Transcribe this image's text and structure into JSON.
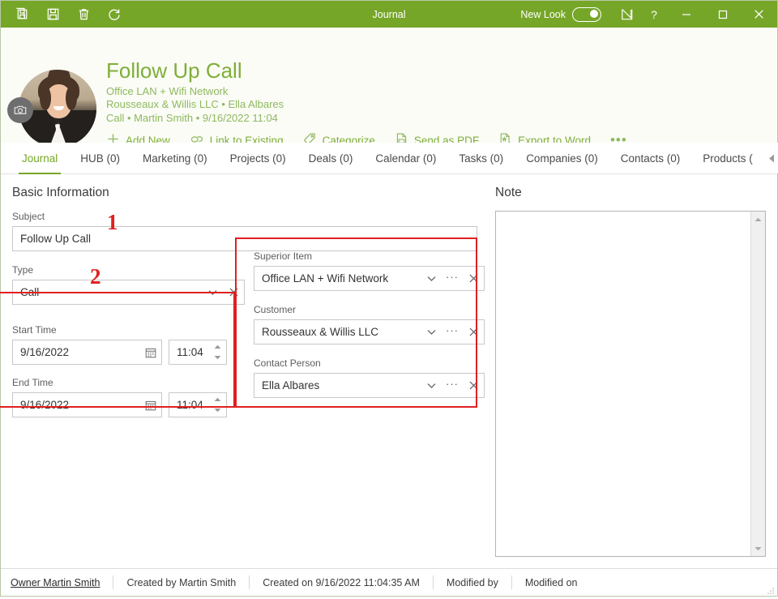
{
  "titlebar": {
    "title": "Journal",
    "buttons": [
      {
        "name": "save-and-new-icon",
        "label": "Save and New"
      },
      {
        "name": "save-icon",
        "label": "Save"
      },
      {
        "name": "delete-icon",
        "label": "Delete"
      },
      {
        "name": "refresh-icon",
        "label": "Refresh"
      }
    ],
    "new_look_label": "New Look",
    "new_look_on": true,
    "designer_icon": "ruler-icon",
    "help_label": "?",
    "minimize_label": "—",
    "maximize_label": "□",
    "close_label": "✕",
    "accent_color": "#76a628"
  },
  "header": {
    "title": "Follow Up Call",
    "subtitle_1": "Office LAN + Wifi Network",
    "subtitle_2": "Rousseaux & Willis LLC • Ella Albares",
    "subtitle_3": "Call • Martin Smith • 9/16/2022 11:04",
    "avatar_camera_icon": "camera-icon",
    "actions": [
      {
        "label": "Add New",
        "icon": "plus-icon"
      },
      {
        "label": "Link to Existing",
        "icon": "link-icon"
      },
      {
        "label": "Categorize",
        "icon": "tag-icon"
      },
      {
        "label": "Send as PDF",
        "icon": "pdf-icon"
      },
      {
        "label": "Export to Word",
        "icon": "word-icon"
      },
      {
        "label": "•••",
        "icon": "more-icon"
      }
    ]
  },
  "tabs": {
    "items": [
      {
        "label": "Journal",
        "active": true
      },
      {
        "label": "HUB (0)",
        "active": false
      },
      {
        "label": "Marketing (0)",
        "active": false
      },
      {
        "label": "Projects (0)",
        "active": false
      },
      {
        "label": "Deals (0)",
        "active": false
      },
      {
        "label": "Calendar (0)",
        "active": false
      },
      {
        "label": "Tasks (0)",
        "active": false
      },
      {
        "label": "Companies (0)",
        "active": false
      },
      {
        "label": "Contacts (0)",
        "active": false
      },
      {
        "label": "Products (",
        "active": false
      }
    ],
    "scroll_left_icon": "chevron-left-icon",
    "scroll_right_icon": "chevron-right-icon"
  },
  "form": {
    "section_title": "Basic Information",
    "subject": {
      "label": "Subject",
      "value": "Follow Up Call",
      "annotation": "1"
    },
    "type": {
      "label": "Type",
      "value": "Call",
      "annotation": "2"
    },
    "start_time": {
      "label": "Start Time",
      "date": "9/16/2022",
      "time": "11:04"
    },
    "end_time": {
      "label": "End Time",
      "date": "9/16/2022",
      "time": "11:04"
    },
    "superior_item": {
      "label": "Superior Item",
      "value": "Office LAN + Wifi Network"
    },
    "customer": {
      "label": "Customer",
      "value": "Rousseaux & Willis LLC"
    },
    "contact_person": {
      "label": "Contact Person",
      "value": "Ella Albares"
    },
    "note": {
      "label": "Note",
      "value": ""
    },
    "highlight_color": "#e02020"
  },
  "statusbar": {
    "cells": [
      {
        "label": "Owner Martin Smith",
        "link": true
      },
      {
        "label": "Created by Martin Smith",
        "link": false
      },
      {
        "label": "Created on 9/16/2022 11:04:35 AM",
        "link": false
      },
      {
        "label": "Modified by",
        "link": false
      },
      {
        "label": "Modified on",
        "link": false
      }
    ]
  }
}
